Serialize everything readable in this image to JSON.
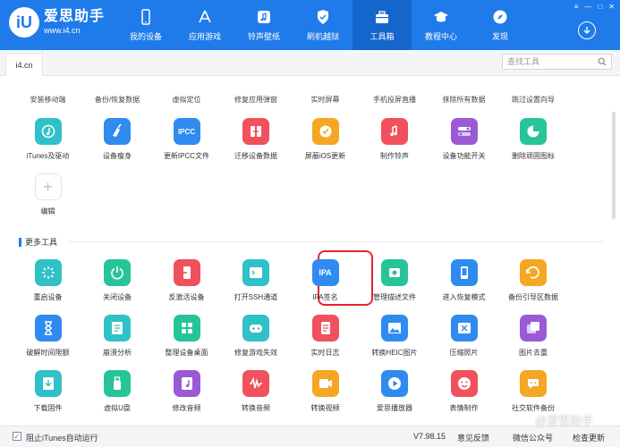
{
  "app": {
    "name": "爱思助手",
    "url": "www.i4.cn",
    "logo_mark": "iU",
    "accent": "#1f7bea"
  },
  "nav": [
    {
      "label": "我的设备",
      "icon": "phone-icon"
    },
    {
      "label": "应用游戏",
      "icon": "app-store-icon"
    },
    {
      "label": "铃声壁纸",
      "icon": "music-note-icon"
    },
    {
      "label": "刷机越狱",
      "icon": "shield-icon"
    },
    {
      "label": "工具箱",
      "icon": "toolbox-icon",
      "active": true
    },
    {
      "label": "教程中心",
      "icon": "graduation-cap-icon"
    },
    {
      "label": "发现",
      "icon": "compass-icon"
    }
  ],
  "tab": {
    "label": "i4.cn"
  },
  "search": {
    "placeholder": "查找工具"
  },
  "top_labels": [
    "安装移动端",
    "备份/恢复数据",
    "虚拟定位",
    "修复应用弹窗",
    "实时屏幕",
    "手机投屏直播",
    "抹除所有数据",
    "跳过设置向导"
  ],
  "tools": [
    {
      "label": "iTunes及驱动",
      "icon": "itunes-icon",
      "color": "#2fc1c7"
    },
    {
      "label": "设备瘦身",
      "icon": "broom-icon",
      "color": "#2f8bf0"
    },
    {
      "label": "更新IPCC文件",
      "icon": "ipcc-icon",
      "color": "#2f8bf0",
      "text": "IPCC"
    },
    {
      "label": "迁移设备数据",
      "icon": "migrate-icon",
      "color": "#f0515c"
    },
    {
      "label": "屏蔽iOS更新",
      "icon": "block-update-icon",
      "color": "#f5a623"
    },
    {
      "label": "制作铃声",
      "icon": "ringtone-icon",
      "color": "#f0515c"
    },
    {
      "label": "设备功能开关",
      "icon": "toggle-icon",
      "color": "#9b59d6"
    },
    {
      "label": "删除顽固图标",
      "icon": "pie-icon",
      "color": "#27c49a"
    },
    {
      "label": "编辑",
      "icon": "plus-icon",
      "color": "#ffffff"
    }
  ],
  "section": {
    "title": "更多工具"
  },
  "more_tools": [
    {
      "label": "重启设备",
      "icon": "restart-icon",
      "color": "#2fc1c7"
    },
    {
      "label": "关闭设备",
      "icon": "power-icon",
      "color": "#27c49a"
    },
    {
      "label": "反激活设备",
      "icon": "deactivate-icon",
      "color": "#f0515c"
    },
    {
      "label": "打开SSH通道",
      "icon": "terminal-icon",
      "color": "#2fc1c7"
    },
    {
      "label": "IPA签名",
      "icon": "ipa-icon",
      "color": "#2f8bf0",
      "text": "IPA"
    },
    {
      "label": "管理描述文件",
      "icon": "gear-file-icon",
      "color": "#27c49a"
    },
    {
      "label": "进入恢复模式",
      "icon": "recovery-icon",
      "color": "#2f8bf0"
    },
    {
      "label": "备份引导区数据",
      "icon": "backup-boot-icon",
      "color": "#f5a623"
    },
    {
      "label": "破解时间限额",
      "icon": "hourglass-icon",
      "color": "#2f8bf0"
    },
    {
      "label": "崩溃分析",
      "icon": "crash-icon",
      "color": "#2fc1c7"
    },
    {
      "label": "整理设备桌面",
      "icon": "grid-icon",
      "color": "#27c49a"
    },
    {
      "label": "修复游戏失效",
      "icon": "gamepad-icon",
      "color": "#2fc1c7"
    },
    {
      "label": "实时日志",
      "icon": "log-icon",
      "color": "#f0515c"
    },
    {
      "label": "转换HEIC图片",
      "icon": "heic-icon",
      "color": "#2f8bf0"
    },
    {
      "label": "压缩照片",
      "icon": "compress-icon",
      "color": "#2f8bf0"
    },
    {
      "label": "图片去重",
      "icon": "dedupe-icon",
      "color": "#9b59d6"
    },
    {
      "label": "下载固件",
      "icon": "download-firmware-icon",
      "color": "#2fc1c7"
    },
    {
      "label": "虚拟U盘",
      "icon": "usb-icon",
      "color": "#27c49a"
    },
    {
      "label": "修改音频",
      "icon": "audio-edit-icon",
      "color": "#9b59d6"
    },
    {
      "label": "转换音频",
      "icon": "waveform-icon",
      "color": "#f0515c"
    },
    {
      "label": "转换视频",
      "icon": "video-icon",
      "color": "#f5a623"
    },
    {
      "label": "爱思播放器",
      "icon": "player-icon",
      "color": "#2f8bf0"
    },
    {
      "label": "表情制作",
      "icon": "emoji-icon",
      "color": "#f0515c"
    },
    {
      "label": "社交软件备份",
      "icon": "chat-backup-icon",
      "color": "#f5a623"
    }
  ],
  "footer": {
    "itunes_autorun": "阻止iTunes自动运行",
    "itunes_checked": true,
    "version": "V7.98.15",
    "feedback": "意见反馈",
    "wechat": "微信公众号",
    "update": "检查更新"
  },
  "watermark": "@爱思助手"
}
